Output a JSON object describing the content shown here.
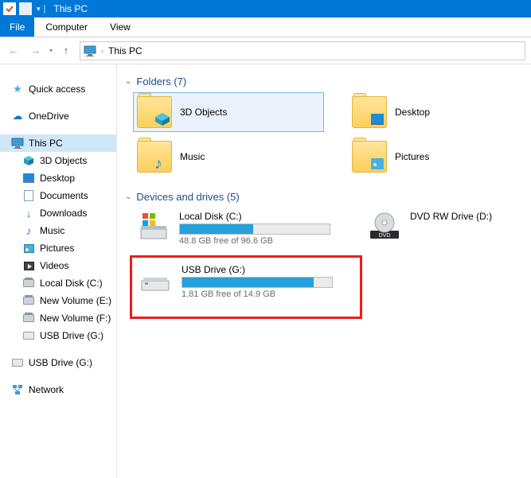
{
  "window": {
    "title": "This PC"
  },
  "ribbon": {
    "file": "File",
    "tabs": [
      "Computer",
      "View"
    ]
  },
  "breadcrumb": {
    "current": "This PC"
  },
  "sidebar": {
    "quick_access": "Quick access",
    "onedrive": "OneDrive",
    "this_pc": "This PC",
    "items": [
      {
        "label": "3D Objects"
      },
      {
        "label": "Desktop"
      },
      {
        "label": "Documents"
      },
      {
        "label": "Downloads"
      },
      {
        "label": "Music"
      },
      {
        "label": "Pictures"
      },
      {
        "label": "Videos"
      },
      {
        "label": "Local Disk (C:)"
      },
      {
        "label": "New Volume (E:)"
      },
      {
        "label": "New Volume (F:)"
      },
      {
        "label": "USB Drive (G:)"
      }
    ],
    "usb_external": "USB Drive (G:)",
    "network": "Network"
  },
  "groups": {
    "folders": {
      "header": "Folders (7)",
      "items": [
        "3D Objects",
        "Desktop",
        "Music",
        "Pictures"
      ]
    },
    "drives": {
      "header": "Devices and drives (5)",
      "items": [
        {
          "name": "Local Disk (C:)",
          "free": "48.8 GB free of 96.6 GB",
          "fill_pct": 49
        },
        {
          "name": "DVD RW Drive (D:)"
        },
        {
          "name": "USB Drive (G:)",
          "free": "1.81 GB free of 14.9 GB",
          "fill_pct": 88
        }
      ]
    }
  }
}
